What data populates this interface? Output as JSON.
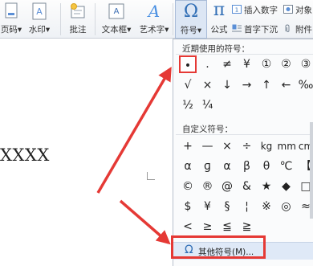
{
  "ribbon": {
    "page_number_label": "页码",
    "watermark_label": "水印",
    "comment_label": "批注",
    "textbox_label": "文本框",
    "wordart_label": "艺术字",
    "symbol_label": "符号",
    "formula_label": "公式",
    "insert_number_label": "插入数字",
    "object_label": "对象",
    "drop_cap_label": "首字下沉",
    "attachment_label": "附件",
    "symbol_glyph": "Ω",
    "formula_glyph": "π",
    "dropdown_arrow": "▾"
  },
  "document": {
    "text": "XXXX"
  },
  "symbol_panel": {
    "recent_title": "近期使用的符号：",
    "recent_rows": [
      [
        "•",
        ".",
        "≠",
        "¥",
        "①",
        "②",
        "③"
      ],
      [
        "√",
        "×",
        "↓",
        "→",
        "↑",
        "←",
        "‰"
      ],
      [
        "½",
        "¼"
      ]
    ],
    "custom_title": "自定义符号：",
    "custom_rows": [
      [
        "+",
        "—",
        "×",
        "÷",
        "kg",
        "mm",
        "cm"
      ],
      [
        "α",
        "ɡ",
        "α",
        "β",
        "θ",
        "℃",
        "【"
      ],
      [
        "©",
        "®",
        "@",
        "&",
        "★",
        "◆",
        "□"
      ],
      [
        "$",
        "¥",
        "§",
        "¦",
        "※",
        "◎",
        "≈"
      ],
      [
        "<",
        "≥",
        "≦",
        "≧"
      ]
    ],
    "more_icon": "Ω",
    "more_label": "其他符号(M)..."
  },
  "colors": {
    "highlight": "#e53935",
    "menu_hover": "#dfe9f7"
  }
}
